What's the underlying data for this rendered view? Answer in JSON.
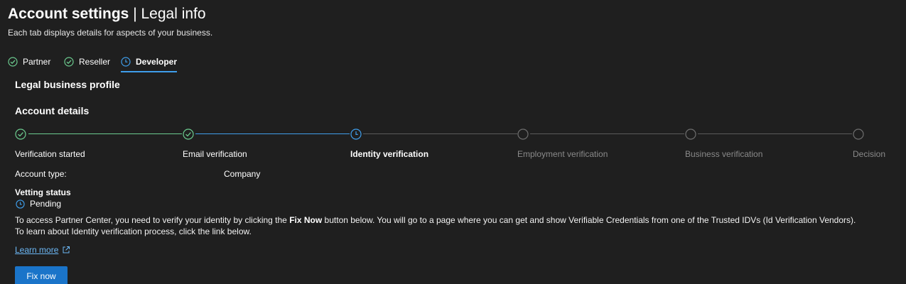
{
  "header": {
    "title_main": "Account settings",
    "title_sep": " | ",
    "title_sub": "Legal info",
    "subtitle": "Each tab displays details for aspects of your business."
  },
  "tabs": [
    {
      "label": "Partner",
      "icon": "check-circle-icon",
      "status": "complete"
    },
    {
      "label": "Reseller",
      "icon": "check-circle-icon",
      "status": "complete"
    },
    {
      "label": "Developer",
      "icon": "clock-icon",
      "status": "active"
    }
  ],
  "sections": {
    "legal_profile": "Legal business profile",
    "account_details": "Account details"
  },
  "stepper": {
    "steps": [
      {
        "label": "Verification started",
        "state": "complete"
      },
      {
        "label": "Email verification",
        "state": "complete"
      },
      {
        "label": "Identity verification",
        "state": "current"
      },
      {
        "label": "Employment verification",
        "state": "pending"
      },
      {
        "label": "Business verification",
        "state": "pending"
      },
      {
        "label": "Decision",
        "state": "pending"
      }
    ]
  },
  "account": {
    "type_label": "Account type:",
    "type_value": "Company"
  },
  "vetting": {
    "title": "Vetting status",
    "status": "Pending",
    "message_prefix": "To access Partner Center, you need to verify your identity by clicking the ",
    "message_bold": "Fix Now",
    "message_suffix": " button below. You will go to a page where you can get and show Verifiable Credentials from one of the Trusted IDVs (Id Verification Vendors).",
    "message_line2": "To learn about Identity verification process, click the link below."
  },
  "links": {
    "learn_more": "Learn more"
  },
  "actions": {
    "fix_now": "Fix now"
  },
  "colors": {
    "background": "#1f1f1f",
    "complete": "#6ccb8f",
    "active": "#3f9eeb",
    "pending": "#6e6e6e",
    "button": "#1a74c9",
    "link": "#6cb8f6"
  }
}
